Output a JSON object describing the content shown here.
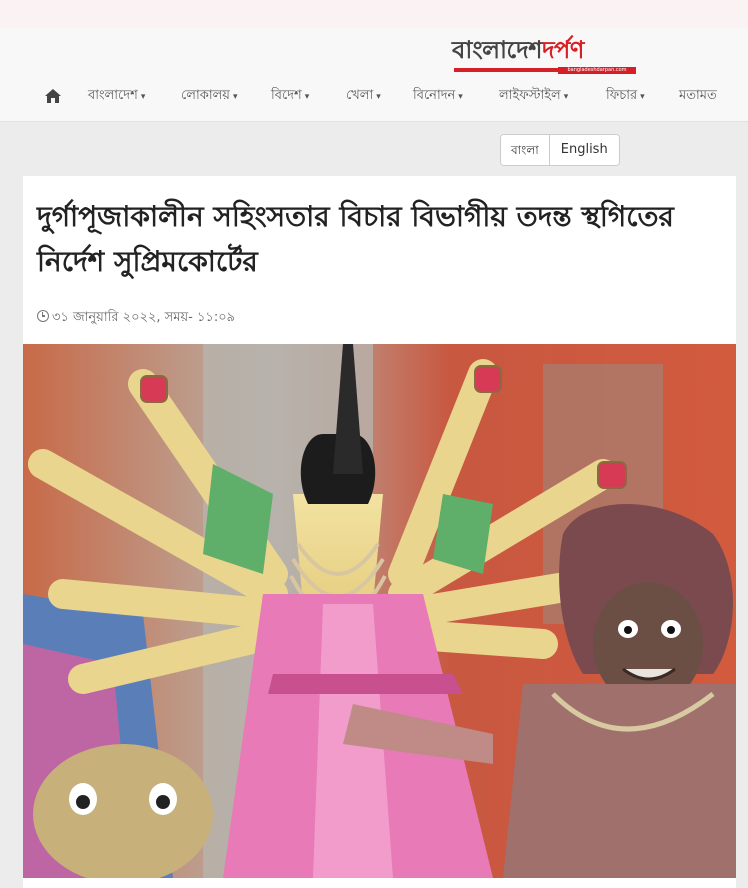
{
  "site": {
    "logo": {
      "part1": "বাংলাদেশ",
      "part2": "দর্পণ",
      "url": "bangladeshdarpan.com"
    }
  },
  "nav": {
    "home_icon": "home-icon",
    "items": [
      {
        "label": "বাংলাদেশ",
        "dropdown": true
      },
      {
        "label": "লোকালয়",
        "dropdown": true
      },
      {
        "label": "বিদেশ",
        "dropdown": true
      },
      {
        "label": "খেলা",
        "dropdown": true
      },
      {
        "label": "বিনোদন",
        "dropdown": true
      },
      {
        "label": "লাইফস্টাইল",
        "dropdown": true
      },
      {
        "label": "ফিচার",
        "dropdown": true
      },
      {
        "label": "মতামত",
        "dropdown": false
      }
    ],
    "caret": "▾"
  },
  "language": {
    "bangla": "বাংলা",
    "english": "English"
  },
  "article": {
    "title": "দুর্গাপূজাকালীন সহিংসতার বিচার বিভাগীয় তদন্ত স্থগিতের নির্দেশ সুপ্রিমকোর্টের",
    "date": "৩১ জানুয়ারি ২০২২, সময়- ১১:০৯",
    "image_icon": "durga-idol-photo"
  },
  "colors": {
    "brand_red": "#d62027",
    "header_bg": "#f8f8f8",
    "page_bg": "#ececec"
  }
}
